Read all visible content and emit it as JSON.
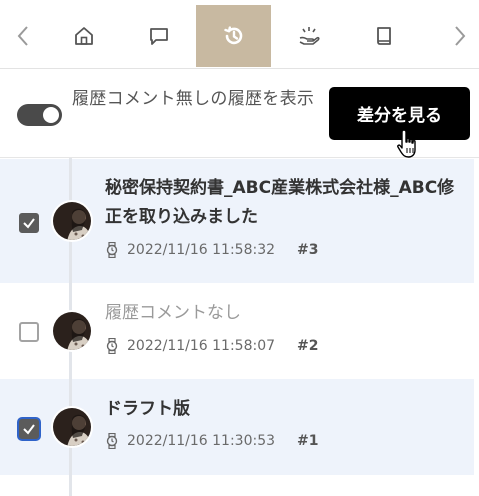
{
  "toolbar": {
    "items": [
      {
        "icon": "chevron-left-icon"
      },
      {
        "icon": "home-icon"
      },
      {
        "icon": "comment-icon"
      },
      {
        "icon": "history-icon",
        "active": true
      },
      {
        "icon": "hand-sparkle-icon"
      },
      {
        "icon": "book-icon"
      },
      {
        "icon": "chevron-right-icon"
      }
    ],
    "active_color": "#c8b9a1"
  },
  "options": {
    "toggle_label": "履歴コメント無しの履歴を表示",
    "toggle_on": true,
    "diff_button": "差分を見る"
  },
  "history": [
    {
      "title": "秘密保持契約書_ABC産業株式会社様_ABC修正を取り込みました",
      "timestamp": "2022/11/16 11:58:32",
      "version": "#3",
      "checked": true,
      "has_comment": true
    },
    {
      "title": "履歴コメントなし",
      "timestamp": "2022/11/16 11:58:07",
      "version": "#2",
      "checked": false,
      "has_comment": false
    },
    {
      "title": "ドラフト版",
      "timestamp": "2022/11/16 11:30:53",
      "version": "#1",
      "checked": true,
      "has_comment": true
    }
  ],
  "colors": {
    "selected_row": "#eef3fb",
    "button": "#000000",
    "toggle": "#4a4a4a"
  }
}
